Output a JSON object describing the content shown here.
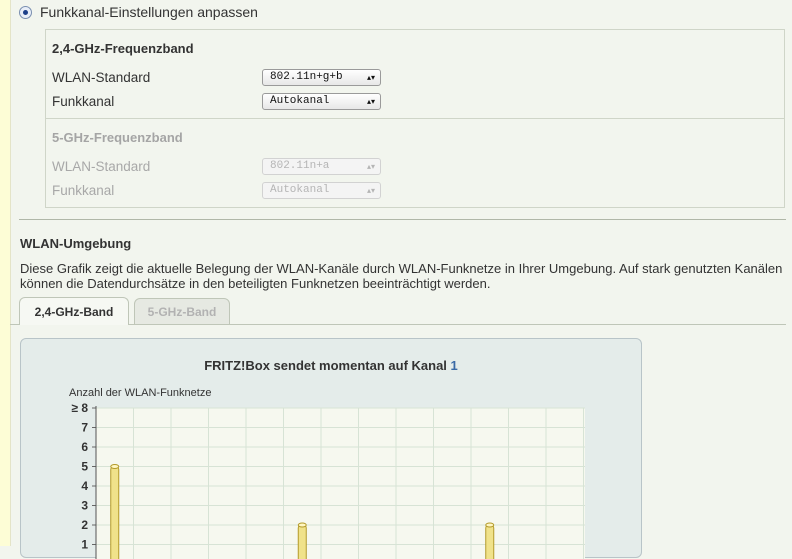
{
  "radio_label": "Funkkanal-Einstellungen anpassen",
  "band24": {
    "title": "2,4-GHz-Frequenzband",
    "rows": [
      {
        "label": "WLAN-Standard",
        "value": "802.11n+g+b"
      },
      {
        "label": "Funkkanal",
        "value": "Autokanal"
      }
    ]
  },
  "band5": {
    "title": "5-GHz-Frequenzband",
    "rows": [
      {
        "label": "WLAN-Standard",
        "value": "802.11n+a"
      },
      {
        "label": "Funkkanal",
        "value": "Autokanal"
      }
    ]
  },
  "umgebung": {
    "title": "WLAN-Umgebung",
    "description": "Diese Grafik zeigt die aktuelle Belegung der WLAN-Kanäle durch WLAN-Funknetze in Ihrer Umgebung. Auf stark genutzten Kanälen können die Datendurchsätze in den beteiligten Funknetzen beeinträchtigt werden.",
    "tabs": [
      "2,4-GHz-Band",
      "5-GHz-Band"
    ]
  },
  "chart_heading": {
    "prefix": "FRITZ!Box sendet momentan auf Kanal ",
    "channel": "1"
  },
  "colors": {
    "bar_fill": "#f0e28a",
    "bar_stroke": "#b39a2a",
    "grid": "#d7e3d5",
    "plot_bg": "#f6f8ef",
    "channel_accent": "#3a6aa6"
  },
  "chart_data": {
    "type": "bar",
    "ylabel": "Anzahl der WLAN-Funknetze",
    "yticks": [
      "1",
      "2",
      "3",
      "4",
      "5",
      "6",
      "7",
      "≥ 8"
    ],
    "ylim": [
      0,
      8
    ],
    "grid": true,
    "bars": [
      {
        "x": 1,
        "value": 5
      },
      {
        "x": 6,
        "value": 2
      },
      {
        "x": 11,
        "value": 2
      }
    ]
  }
}
